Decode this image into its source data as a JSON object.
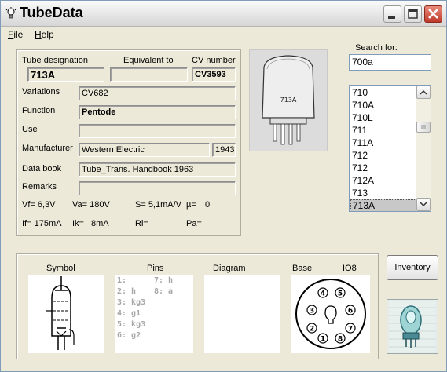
{
  "window": {
    "title": "TubeData"
  },
  "menu": [
    {
      "label": "File",
      "underline": "F",
      "rest": "ile"
    },
    {
      "label": "Help",
      "underline": "H",
      "rest": "elp"
    }
  ],
  "headers": {
    "designation": "Tube designation",
    "equivalent": "Equivalent to",
    "cv": "CV number"
  },
  "values": {
    "designation": "713A",
    "equivalent": "",
    "cv": "CV3593"
  },
  "rows": {
    "variations": {
      "label": "Variations",
      "value": "CV682"
    },
    "function": {
      "label": "Function",
      "value": "Pentode"
    },
    "use": {
      "label": "Use",
      "value": ""
    },
    "manufacturer": {
      "label": "Manufacturer",
      "value": "Western Electric",
      "year": "1943"
    },
    "databook": {
      "label": "Data book",
      "value": "Tube_Trans. Handbook 1963"
    },
    "remarks": {
      "label": "Remarks",
      "value": ""
    }
  },
  "params": {
    "vf": "Vf= 6,3V",
    "va": "Va= 180V",
    "s": "S= 5,1mA/V",
    "mu": "µ=",
    "mu_val": "0",
    "if": "If= 175mA",
    "ik": "Ik=",
    "ik_val": "8mA",
    "ri": "Ri=",
    "pa": "Pa="
  },
  "tube_image": {
    "label": "713A"
  },
  "search": {
    "label": "Search for:",
    "value": "700a"
  },
  "list": {
    "items": [
      "710",
      "710A",
      "710L",
      "711",
      "711A",
      "712",
      "712",
      "712A",
      "713",
      "713A"
    ],
    "selected": "713A"
  },
  "bottom": {
    "symbol": "Symbol",
    "pins": "Pins",
    "diagram": "Diagram",
    "base": "Base",
    "base_type": "IO8",
    "pin_col1": [
      "1:",
      "2: h",
      "3: kg3",
      "4: g1",
      "5: kg3",
      "6: g2"
    ],
    "pin_col2": [
      "7: h",
      "8: a"
    ],
    "base_numbers": [
      "1",
      "2",
      "3",
      "4",
      "5",
      "6",
      "7",
      "8"
    ]
  },
  "buttons": {
    "inventory": "Inventory"
  },
  "icons": {
    "title": "lightbulb-icon",
    "minimize": "minimize-icon",
    "maximize": "maximize-icon",
    "close": "close-icon"
  },
  "colors": {
    "close_button": "#c0392b",
    "list_selected": "#c8c8c8",
    "pin_text": "#a6a6a6"
  }
}
